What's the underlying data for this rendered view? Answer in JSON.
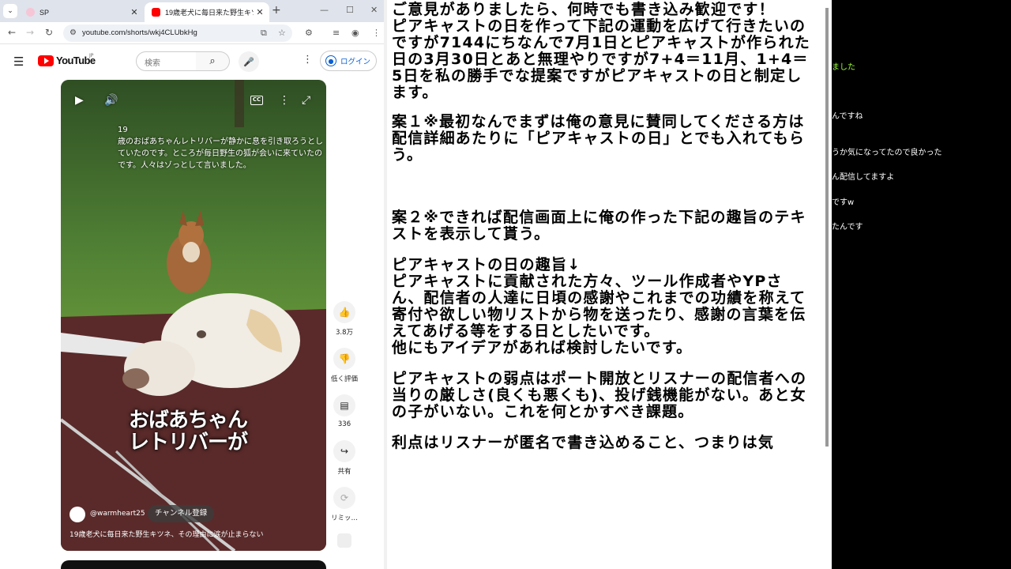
{
  "browser": {
    "tabs": [
      {
        "title": "SP",
        "active": false
      },
      {
        "title": "19歳老犬に毎日来た野生キツネ、",
        "active": true
      }
    ],
    "new_tab_label": "+",
    "window_controls": {
      "minimize": "—",
      "maximize": "☐",
      "close": "✕"
    },
    "url": "youtube.com/shorts/wkj4CLUbkHg"
  },
  "youtube": {
    "logo": "YouTube",
    "region": "JP",
    "search_placeholder": "検索",
    "login_label": "ログイン",
    "video": {
      "subtitle": "19\n歳のおばあちゃんレトリバーが静かに息を引き取ろうとしていたのです。ところが毎日野生の狐が会いに来ていたのです。人々はゾっとして言いました。",
      "caption": "おばあちゃん\nレトリバーが",
      "channel": "@warmheart25",
      "subscribe_label": "チャンネル登録",
      "title": "19歳老犬に毎日来た野生キツネ、その理由に涙が止まらない"
    },
    "actions": {
      "like_count": "3.8万",
      "dislike_label": "低く評価",
      "comment_count": "336",
      "share_label": "共有",
      "remix_label": "リミッ…"
    }
  },
  "document": {
    "paragraphs": [
      "ご意見がありましたら、何時でも書き込み歓迎です！\nピアキャストの日を作って下記の運動を広げて行きたいのですが7144にちなんで7月1日とピアキャストが作られた日の3月30日とあと無理やりですが7+4＝11月、1+4＝5日を私の勝手でな提案ですがピアキャストの日と制定します。",
      "案１※最初なんでまずは俺の意見に賛同してくださる方は配信詳細あたりに「ピアキャストの日」とでも入れてもらう。",
      "案２※できれば配信画面上に俺の作った下記の趣旨のテキストを表示して貰う。",
      "ピアキャストの日の趣旨↓\nピアキャストに貢献された方々、ツール作成者やYPさん、配信者の人達に日頃の感謝やこれまでの功績を称えて寄付や欲しい物リストから物を送ったり、感謝の言葉を伝えてあげる等をする日としたいです。\n他にもアイデアがあれば検討したいです。",
      "ピアキャストの弱点はポート開放とリスナーの配信者への当りの厳しさ(良くも悪くも)、投げ銭機能がない。あと女の子がいない。これを何とかすべき課題。",
      "利点はリスナーが匿名で書き込めること、つまりは気"
    ]
  },
  "chat": {
    "messages": [
      "ました",
      "んですね",
      "うか気になってたので良かった",
      "ん配信してますよ",
      "ですw",
      "たんです"
    ]
  }
}
